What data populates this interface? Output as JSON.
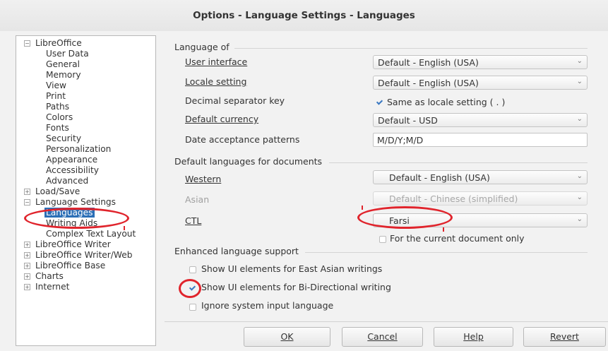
{
  "window": {
    "title": "Options - Language Settings - Languages"
  },
  "tree": {
    "items": [
      {
        "label": "LibreOffice",
        "level": 0,
        "expander": "−"
      },
      {
        "label": "User Data",
        "level": 1
      },
      {
        "label": "General",
        "level": 1
      },
      {
        "label": "Memory",
        "level": 1
      },
      {
        "label": "View",
        "level": 1
      },
      {
        "label": "Print",
        "level": 1
      },
      {
        "label": "Paths",
        "level": 1
      },
      {
        "label": "Colors",
        "level": 1
      },
      {
        "label": "Fonts",
        "level": 1
      },
      {
        "label": "Security",
        "level": 1
      },
      {
        "label": "Personalization",
        "level": 1
      },
      {
        "label": "Appearance",
        "level": 1
      },
      {
        "label": "Accessibility",
        "level": 1
      },
      {
        "label": "Advanced",
        "level": 1
      },
      {
        "label": "Load/Save",
        "level": 0,
        "expander": "+"
      },
      {
        "label": "Language Settings",
        "level": 0,
        "expander": "−"
      },
      {
        "label": "Languages",
        "level": 1,
        "selected": true
      },
      {
        "label": "Writing Aids",
        "level": 1
      },
      {
        "label": "Complex Text Layout",
        "level": 1
      },
      {
        "label": "LibreOffice Writer",
        "level": 0,
        "expander": "+"
      },
      {
        "label": "LibreOffice Writer/Web",
        "level": 0,
        "expander": "+"
      },
      {
        "label": "LibreOffice Base",
        "level": 0,
        "expander": "+"
      },
      {
        "label": "Charts",
        "level": 0,
        "expander": "+"
      },
      {
        "label": "Internet",
        "level": 0,
        "expander": "+"
      }
    ]
  },
  "language_of": {
    "heading": "Language of",
    "user_interface": {
      "label": "User interface",
      "value": "Default - English (USA)"
    },
    "locale_setting": {
      "label": "Locale setting",
      "value": "Default - English (USA)"
    },
    "decimal_separator": {
      "label": "Decimal separator key",
      "checkbox_label": "Same as locale setting ( . )",
      "checked": true
    },
    "default_currency": {
      "label": "Default currency",
      "value": "Default - USD"
    },
    "date_patterns": {
      "label": "Date acceptance patterns",
      "value": "M/D/Y;M/D"
    }
  },
  "default_languages": {
    "heading": "Default languages for documents",
    "western": {
      "label": "Western",
      "value": "Default - English (USA)"
    },
    "asian": {
      "label": "Asian",
      "value": "Default - Chinese (simplified)"
    },
    "ctl": {
      "label": "CTL",
      "value": "Farsi"
    },
    "current_doc_only": {
      "label": "For the current document only",
      "checked": false
    }
  },
  "enhanced": {
    "heading": "Enhanced language support",
    "east_asian": {
      "label": "Show UI elements for East Asian writings",
      "checked": false
    },
    "bidi": {
      "label": "Show UI elements for Bi-Directional writing",
      "checked": true
    },
    "ignore_input": {
      "label": "Ignore system input language",
      "checked": false
    }
  },
  "buttons": {
    "ok": "OK",
    "cancel": "Cancel",
    "help": "Help",
    "revert": "Revert"
  },
  "colors": {
    "accent": "#2b6fb6",
    "annotation": "#e0242c"
  },
  "icons": {
    "combo_arrow": "chevron-down-icon",
    "check": "checkmark-icon"
  }
}
